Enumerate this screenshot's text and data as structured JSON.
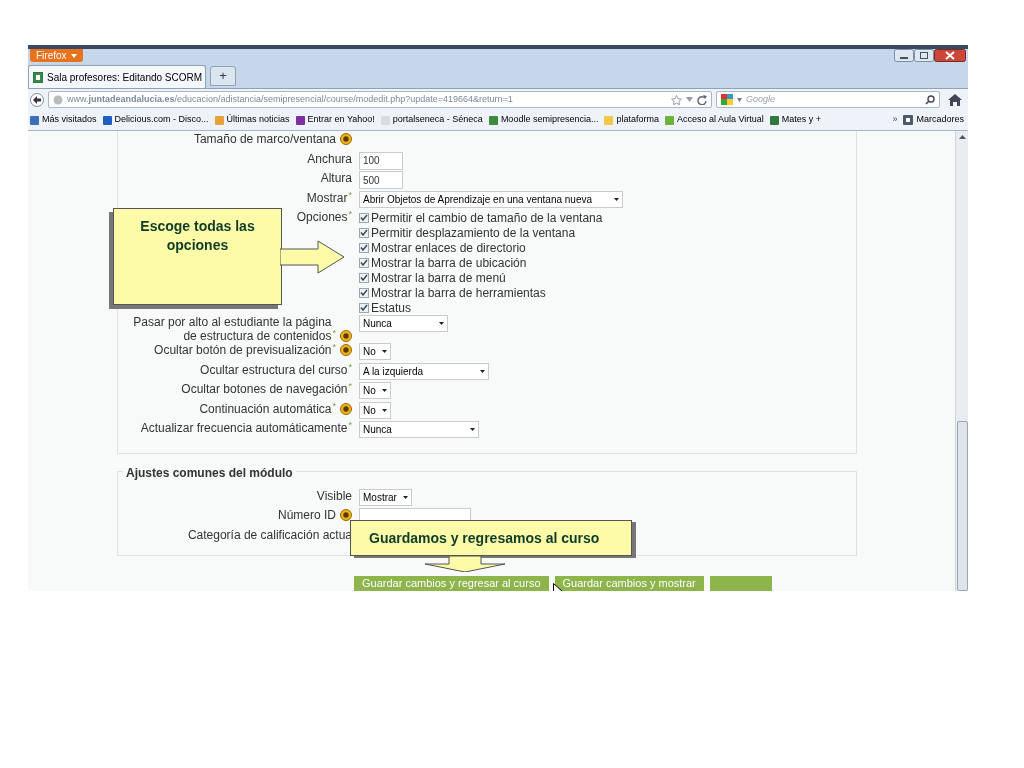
{
  "browser": {
    "app_button": "Firefox",
    "tab_title": "Sala profesores: Editando SCORM",
    "new_tab": "+",
    "url": "www.**juntadeandalucia.es**/educacion/adistancia/semipresencial/course/modedit.php?update=419664&return=1",
    "search_placeholder": "Google",
    "bookmarks": [
      {
        "label": "Más visitados",
        "color": "#3b6fb6"
      },
      {
        "label": "Delicious.com - Disco...",
        "color": "#1f5fbf"
      },
      {
        "label": "Últimas noticias",
        "color": "#e8a13a"
      },
      {
        "label": "Entrar en Yahoo!",
        "color": "#7b2fa0"
      },
      {
        "label": "portalseneca - Séneca",
        "color": "#d8dde3"
      },
      {
        "label": "Moodle semipresencia...",
        "color": "#3d8a3d"
      },
      {
        "label": "plataforma",
        "color": "#f0c94a"
      },
      {
        "label": "Acceso al Aula Virtual",
        "color": "#6fb23a"
      },
      {
        "label": "Mates y +",
        "color": "#2f7a3a"
      }
    ],
    "more": "»",
    "bookmarks_menu": "Marcadores"
  },
  "sections": [
    {
      "rows": [
        {
          "kind": "label",
          "label": "Tamaño de marco/ventana",
          "help": true
        },
        {
          "kind": "text",
          "label": "Anchura",
          "help": false,
          "value": "100"
        },
        {
          "kind": "text",
          "label": "Altura",
          "help": false,
          "value": "500"
        },
        {
          "kind": "select",
          "label": "Mostrar",
          "required_mark": "*",
          "help": false,
          "value": "Abrir Objetos de Aprendizaje en una ventana nueva"
        },
        {
          "kind": "checkboxes",
          "label": "Opciones",
          "required_mark": "*",
          "help": false,
          "options": [
            {
              "label": "Permitir el cambio de tamaño de la ventana",
              "checked": true
            },
            {
              "label": "Permitir desplazamiento de la ventana",
              "checked": true
            },
            {
              "label": "Mostrar enlaces de directorio",
              "checked": true
            },
            {
              "label": "Mostrar la barra de ubicación",
              "checked": true
            },
            {
              "label": "Mostrar la barra de menú",
              "checked": true
            },
            {
              "label": "Mostrar la barra de herramientas",
              "checked": true
            },
            {
              "label": "Estatus",
              "checked": true
            }
          ]
        },
        {
          "kind": "select",
          "label": "Pasar por alto al estudiante la página de estructura de contenidos",
          "required_mark": "*",
          "help": true,
          "value": "Nunca"
        },
        {
          "kind": "select",
          "label": "Ocultar botón de previsualización",
          "required_mark": "*",
          "help": true,
          "value": "No"
        },
        {
          "kind": "select",
          "label": "Ocultar estructura del curso",
          "required_mark": "*",
          "help": false,
          "value": "A la izquierda"
        },
        {
          "kind": "select",
          "label": "Ocultar botones de navegación",
          "required_mark": "*",
          "help": false,
          "value": "No"
        },
        {
          "kind": "select",
          "label": "Continuación automática",
          "required_mark": "*",
          "help": true,
          "value": "No"
        },
        {
          "kind": "select",
          "label": "Actualizar frecuencia automáticamente",
          "required_mark": "*",
          "help": false,
          "value": "Nunca"
        }
      ]
    },
    {
      "legend": "Ajustes comunes del módulo",
      "rows": [
        {
          "kind": "select",
          "label": "Visible",
          "help": false,
          "value": "Mostrar"
        },
        {
          "kind": "text",
          "label": "Número ID",
          "help": true,
          "value": ""
        },
        {
          "kind": "label",
          "label": "Categoría de calificación actua",
          "help": false
        }
      ]
    }
  ],
  "buttons": [
    {
      "kind": "full",
      "label": "Guardar cambios y regresar al curso"
    },
    {
      "kind": "full",
      "label": "Guardar cambios y mostrar"
    },
    {
      "kind": "cut"
    }
  ],
  "callouts": [
    {
      "kind": "side",
      "text": "Escoge todas las opciones"
    },
    {
      "kind": "below",
      "text": "Guardamos y regresamos al curso"
    }
  ]
}
